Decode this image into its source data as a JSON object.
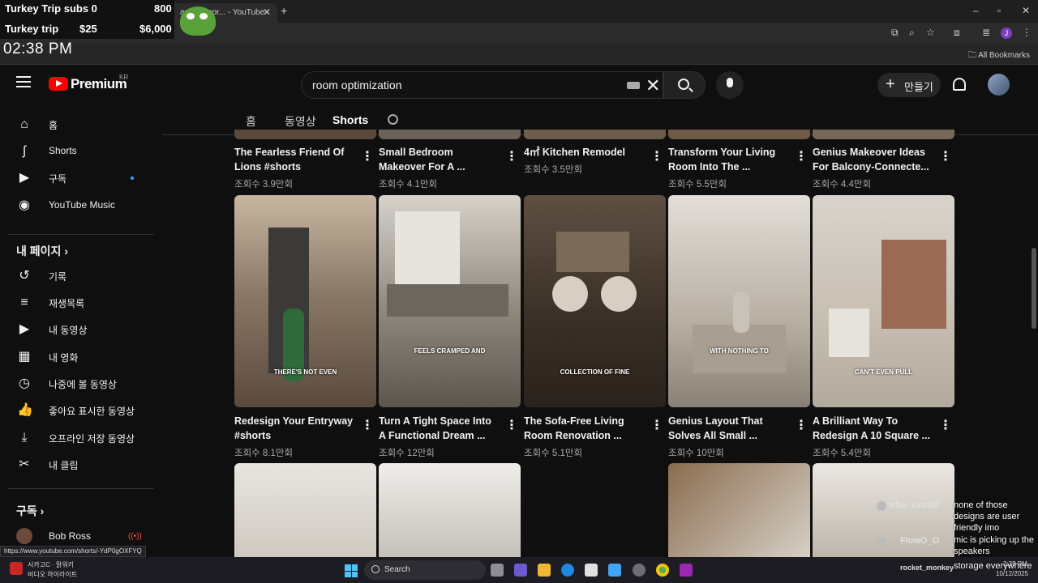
{
  "stream_overlay": {
    "line1_label": "Turkey Trip subs 0",
    "line1_value": "800",
    "line2_label": "Turkey trip",
    "line2_value1": "$25",
    "line2_value2": "$6,000",
    "clock": "02:38 PM"
  },
  "browser": {
    "tab_title": "amy Decor... - YouTube",
    "bookmarks_label": "All Bookmarks",
    "profile_initial": "J",
    "status_url": "https://www.youtube.com/shorts/-YdP0gOXFYQ"
  },
  "header": {
    "brand": "Premium",
    "region": "KR",
    "search_value": "room optimization",
    "create_label": "만들기",
    "create_plus": "+"
  },
  "filter_tabs": [
    {
      "label": "홈"
    },
    {
      "label": "동영상"
    },
    {
      "label": "Shorts"
    }
  ],
  "sidebar": {
    "main": [
      {
        "label": "홈",
        "icon": "home-icon",
        "glyph": "⌂"
      },
      {
        "label": "Shorts",
        "icon": "shorts-icon",
        "glyph": "ʃ"
      },
      {
        "label": "구독",
        "icon": "subscriptions-icon",
        "glyph": "▶"
      },
      {
        "label": "YouTube Music",
        "icon": "music-icon",
        "glyph": "◉"
      }
    ],
    "my_page_heading": "내 페이지",
    "my_page": [
      {
        "label": "기록",
        "icon": "history-icon",
        "glyph": "↺"
      },
      {
        "label": "재생목록",
        "icon": "playlists-icon",
        "glyph": "≡"
      },
      {
        "label": "내 동영상",
        "icon": "my-videos-icon",
        "glyph": "▶"
      },
      {
        "label": "내 영화",
        "icon": "movies-icon",
        "glyph": "▦"
      },
      {
        "label": "나중에 볼 동영상",
        "icon": "watch-later-icon",
        "glyph": "◷"
      },
      {
        "label": "좋아요 표시한 동영상",
        "icon": "liked-icon",
        "glyph": "👍"
      },
      {
        "label": "오프라인 저장 동영상",
        "icon": "download-icon",
        "glyph": "⤓"
      },
      {
        "label": "내 클립",
        "icon": "clips-icon",
        "glyph": "✂"
      }
    ],
    "subscriptions_heading": "구독",
    "subscriptions": [
      {
        "label": "Bob Ross",
        "live": "((•))"
      }
    ]
  },
  "videos": {
    "row1": [
      {
        "title": "The Fearless Friend Of Lions #shorts",
        "views": "조회수 3.9만회"
      },
      {
        "title": "Small Bedroom Makeover For A ...",
        "views": "조회수 4.1만회"
      },
      {
        "title": "4㎡ Kitchen Remodel",
        "views": "조회수 3.5만회"
      },
      {
        "title": "Transform Your Living Room Into The ...",
        "views": "조회수 5.5만회"
      },
      {
        "title": "Genius Makeover Ideas For Balcony-Connecte...",
        "views": "조회수 4.4만회"
      }
    ],
    "row2": [
      {
        "title": "Redesign Your Entryway #shorts",
        "views": "조회수 8.1만회",
        "caption": "THERE'S NOT EVEN",
        "bg": "#8b7a68"
      },
      {
        "title": "Turn A Tight Space Into A Functional Dream ...",
        "views": "조회수 12만회",
        "caption": "FEELS CRAMPED AND",
        "bg": "#7d766c"
      },
      {
        "title": "The Sofa-Free Living Room Renovation ...",
        "views": "조회수 5.1만회",
        "caption": "COLLECTION OF FINE",
        "bg": "#4a3c30"
      },
      {
        "title": "Genius Layout That Solves All Small ...",
        "views": "조회수 10만회",
        "caption": "WITH NOTHING TO",
        "bg": "#b8afa3"
      },
      {
        "title": "A Brilliant Way To Redesign A 10 Square ...",
        "views": "조회수 5.4만회",
        "caption": "CAN'T EVEN PULL",
        "bg": "#c9c0b4"
      }
    ]
  },
  "chat": [
    {
      "user": "who_vxm02",
      "message": "none of those designs are user friendly imo"
    },
    {
      "user": "FlowO_O",
      "message": "mic is picking up the speakers"
    },
    {
      "user": "rocket_monkey",
      "message": "storage everywhere"
    }
  ],
  "taskbar": {
    "search_label": "Search",
    "news_line1": "시카고C · 맑워키",
    "news_line2": "비디오 하이라이트",
    "time": "2:35 PM",
    "date": "10/12/2025"
  }
}
